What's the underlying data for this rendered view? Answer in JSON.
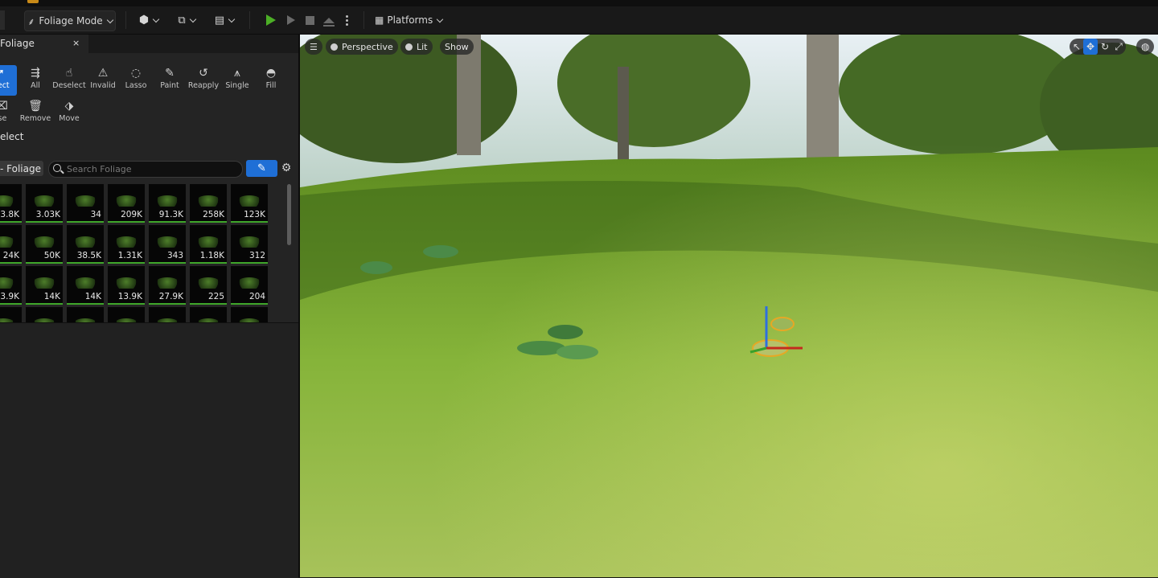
{
  "toolbar": {
    "mode_label": "Foliage Mode",
    "platforms_label": "Platforms",
    "icons": [
      "mode-leaf-icon",
      "add-actor-icon",
      "blueprint-icon",
      "cinematics-icon",
      "play-icon",
      "step-play-icon",
      "stop-icon",
      "eject-icon",
      "more-icon",
      "platforms-icon"
    ],
    "accent_play": "#4caf26"
  },
  "panel": {
    "tab_label": "Foliage",
    "tab_close": "×",
    "tools": [
      {
        "label": "elect",
        "icon": "select-cursor-icon",
        "active": true
      },
      {
        "label": "All",
        "icon": "select-all-icon",
        "active": false
      },
      {
        "label": "Deselect",
        "icon": "deselect-icon",
        "active": false
      },
      {
        "label": "Invalid",
        "icon": "select-invalid-icon",
        "active": false
      },
      {
        "label": "Lasso",
        "icon": "lasso-icon",
        "active": false
      },
      {
        "label": "Paint",
        "icon": "paint-brush-icon",
        "active": false
      },
      {
        "label": "Reapply",
        "icon": "reapply-icon",
        "active": false
      },
      {
        "label": "Single",
        "icon": "single-icon",
        "active": false
      },
      {
        "label": "Fill",
        "icon": "fill-icon",
        "active": false
      },
      {
        "label": "ase",
        "icon": "erase-icon",
        "active": false
      },
      {
        "label": "Remove",
        "icon": "trash-icon",
        "active": false
      },
      {
        "label": "Move",
        "icon": "move-icon",
        "active": false
      }
    ],
    "section_title": "elect",
    "filter_label": "- Foliage",
    "search_placeholder": "Search Foliage",
    "accent": "#1f6fd6",
    "foliage_counts": [
      [
        "3.8K",
        "3.03K",
        "34",
        "209K",
        "91.3K",
        "258K",
        "123K"
      ],
      [
        "24K",
        "50K",
        "38.5K",
        "1.31K",
        "343",
        "1.18K",
        "312"
      ],
      [
        "3.9K",
        "14K",
        "14K",
        "13.9K",
        "27.9K",
        "225",
        "204"
      ],
      [
        "",
        "",
        "",
        "",
        "",
        "",
        ""
      ]
    ]
  },
  "viewport": {
    "perspective_label": "Perspective",
    "lit_label": "Lit",
    "show_label": "Show",
    "right_icons": [
      "select-mode-icon",
      "translate-icon",
      "rotate-icon",
      "scale-icon",
      "world-icon"
    ]
  }
}
